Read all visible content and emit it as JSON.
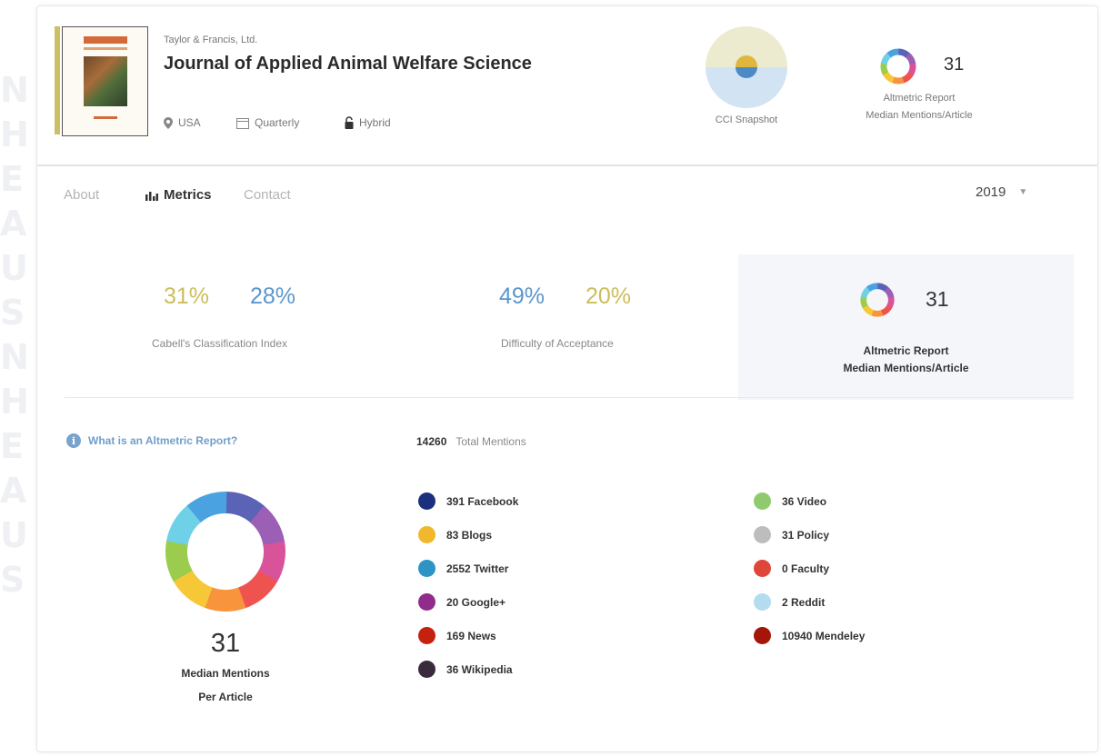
{
  "background_letters": [
    "N",
    "H",
    "E",
    "A",
    "U",
    "S",
    "N",
    "H",
    "E",
    "A",
    "U",
    "S"
  ],
  "journal": {
    "publisher": "Taylor & Francis, Ltd.",
    "title": "Journal of Applied Animal Welfare Science",
    "country": "USA",
    "frequency": "Quarterly",
    "access": "Hybrid"
  },
  "header_widgets": {
    "cci_label": "CCI Snapshot",
    "altmetric_value": "31",
    "altmetric_label_1": "Altmetric Report",
    "altmetric_label_2": "Median Mentions/Article"
  },
  "tabs": [
    {
      "label": "About"
    },
    {
      "label": "Metrics",
      "active": true
    },
    {
      "label": "Contact"
    }
  ],
  "year_selector": {
    "value": "2019"
  },
  "stats": {
    "cci": {
      "value1": "31%",
      "value2": "28%",
      "label": "Cabell's Classification Index"
    },
    "difficulty": {
      "value1": "49%",
      "value2": "20%",
      "label": "Difficulty of Acceptance"
    },
    "altmetric": {
      "value": "31",
      "label_1": "Altmetric Report",
      "label_2": "Median Mentions/Article"
    }
  },
  "altmetric_section": {
    "what_is_link": "What is an Altmetric Report?",
    "total_value": "14260",
    "total_label": "Total Mentions",
    "median_value": "31",
    "median_label_1": "Median Mentions",
    "median_label_2": "Per Article"
  },
  "legend_left": [
    {
      "label": "391 Facebook",
      "color": "#1b2f7e"
    },
    {
      "label": "83 Blogs",
      "color": "#f1b82d"
    },
    {
      "label": "2552 Twitter",
      "color": "#2e94c4"
    },
    {
      "label": "20 Google+",
      "color": "#912b8c"
    },
    {
      "label": "169 News",
      "color": "#c4210f"
    },
    {
      "label": "36 Wikipedia",
      "color": "#3a2a3d"
    }
  ],
  "legend_right": [
    {
      "label": "36 Video",
      "color": "#8fcb6e"
    },
    {
      "label": "31 Policy",
      "color": "#bdbdbd"
    },
    {
      "label": "0 Faculty",
      "color": "#e0453a"
    },
    {
      "label": "2 Reddit",
      "color": "#b4dcef"
    },
    {
      "label": "10940 Mendeley",
      "color": "#a4150a"
    }
  ],
  "colors": {
    "gold": "#cdbd5a",
    "blue": "#5b97cc",
    "altmetric_ring": [
      "#5a63b5",
      "#9b5fb5",
      "#d9539b",
      "#ef5350",
      "#f7943c",
      "#f6c838",
      "#9bcc4e",
      "#6fd1e8",
      "#4aa3e0"
    ]
  }
}
